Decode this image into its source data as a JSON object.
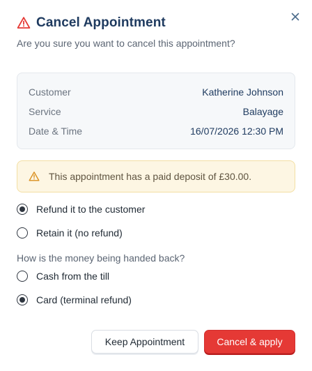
{
  "dialog": {
    "title": "Cancel Appointment",
    "subtitle": "Are you sure you want to cancel this appointment?",
    "close_icon": "close-icon",
    "title_icon": "warning-triangle-icon",
    "accent_color": "#e53935"
  },
  "summary": {
    "rows": [
      {
        "label": "Customer",
        "value": "Katherine Johnson"
      },
      {
        "label": "Service",
        "value": "Balayage"
      },
      {
        "label": "Date & Time",
        "value": "16/07/2026 12:30 PM"
      }
    ]
  },
  "alert": {
    "icon": "warning-triangle-icon",
    "text": "This appointment has a paid deposit of £30.00.",
    "color": "#fdf6e3"
  },
  "refund_options": [
    {
      "label": "Refund it to the customer",
      "selected": true
    },
    {
      "label": "Retain it (no refund)",
      "selected": false
    }
  ],
  "method_question": "How is the money being handed back?",
  "method_options": [
    {
      "label": "Cash from the till",
      "selected": false
    },
    {
      "label": "Card (terminal refund)",
      "selected": true
    }
  ],
  "actions": {
    "keep_label": "Keep Appointment",
    "confirm_label": "Cancel & apply"
  }
}
